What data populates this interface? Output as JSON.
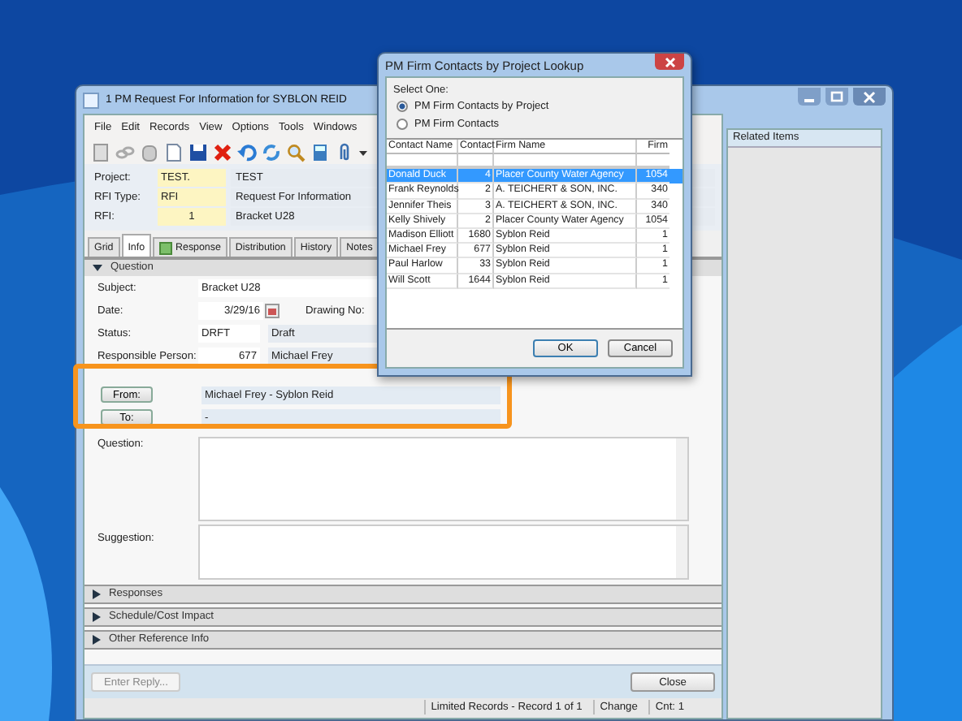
{
  "main_window": {
    "title": "1 PM Request For Information for SYBLON REID"
  },
  "menu": [
    "File",
    "Edit",
    "Records",
    "View",
    "Options",
    "Tools",
    "Windows"
  ],
  "header_fields": [
    {
      "label": "Project:",
      "code": "TEST.",
      "description": "TEST"
    },
    {
      "label": "RFI Type:",
      "code": "RFI",
      "description": "Request For Information"
    },
    {
      "label": "RFI:",
      "code": "1",
      "description": "Bracket U28"
    }
  ],
  "tabs": [
    {
      "label": "Grid",
      "selected": false
    },
    {
      "label": "Info",
      "selected": true
    },
    {
      "label": "Response",
      "selected": false
    },
    {
      "label": "Distribution",
      "selected": false
    },
    {
      "label": "History",
      "selected": false
    },
    {
      "label": "Notes",
      "selected": false
    }
  ],
  "question_section": {
    "title": "Question",
    "expanded": true,
    "subject": {
      "label": "Subject:",
      "value": "Bracket U28"
    },
    "date": {
      "label": "Date:",
      "value": "3/29/16"
    },
    "drawing_no": {
      "label": "Drawing No:"
    },
    "status": {
      "label": "Status:",
      "code": "DRFT",
      "description": "Draft"
    },
    "responsible_person": {
      "label": "Responsible Person:",
      "code": "677",
      "name": "Michael Frey"
    },
    "from": {
      "button": "From:",
      "value": "Michael Frey - Syblon Reid"
    },
    "to": {
      "button": "To:",
      "value": "-"
    },
    "question": {
      "label": "Question:"
    },
    "suggestion": {
      "label": "Suggestion:"
    }
  },
  "collapsed_sections": [
    {
      "title": "Responses",
      "expanded": false
    },
    {
      "title": "Schedule/Cost Impact",
      "expanded": false
    },
    {
      "title": "Other Reference Info",
      "expanded": false
    }
  ],
  "footer": {
    "enter_reply": {
      "label": "Enter Reply...",
      "disabled": true
    },
    "close": {
      "label": "Close",
      "disabled": false
    }
  },
  "status_bar": {
    "records": "Limited Records - Record 1 of 1",
    "change": "Change",
    "count": "Cnt: 1"
  },
  "related_items": {
    "title": "Related Items"
  },
  "lookup_dialog": {
    "title": "PM Firm Contacts by Project Lookup",
    "prompt": "Select One:",
    "options": [
      {
        "label": "PM Firm Contacts by Project",
        "selected": true
      },
      {
        "label": "PM Firm Contacts",
        "selected": false
      }
    ],
    "columns": [
      "Contact Name",
      "Contact",
      "Firm Name",
      "Firm"
    ],
    "rows": [
      {
        "cells": [
          "Donald Duck",
          "4",
          "Placer County Water Agency",
          "1054"
        ],
        "selected": true
      },
      {
        "cells": [
          "Frank Reynolds",
          "2",
          "A. TEICHERT & SON, INC.",
          "340"
        ],
        "selected": false
      },
      {
        "cells": [
          "Jennifer Theis",
          "3",
          "A. TEICHERT & SON, INC.",
          "340"
        ],
        "selected": false
      },
      {
        "cells": [
          "Kelly Shively",
          "2",
          "Placer County Water Agency",
          "1054"
        ],
        "selected": false
      },
      {
        "cells": [
          "Madison Elliott",
          "1680",
          "Syblon Reid",
          "1"
        ],
        "selected": false
      },
      {
        "cells": [
          "Michael Frey",
          "677",
          "Syblon Reid",
          "1"
        ],
        "selected": false
      },
      {
        "cells": [
          "Paul Harlow",
          "33",
          "Syblon Reid",
          "1"
        ],
        "selected": false
      },
      {
        "cells": [
          "Will Scott",
          "1644",
          "Syblon Reid",
          "1"
        ],
        "selected": false
      }
    ],
    "buttons": [
      "OK",
      "Cancel"
    ]
  }
}
